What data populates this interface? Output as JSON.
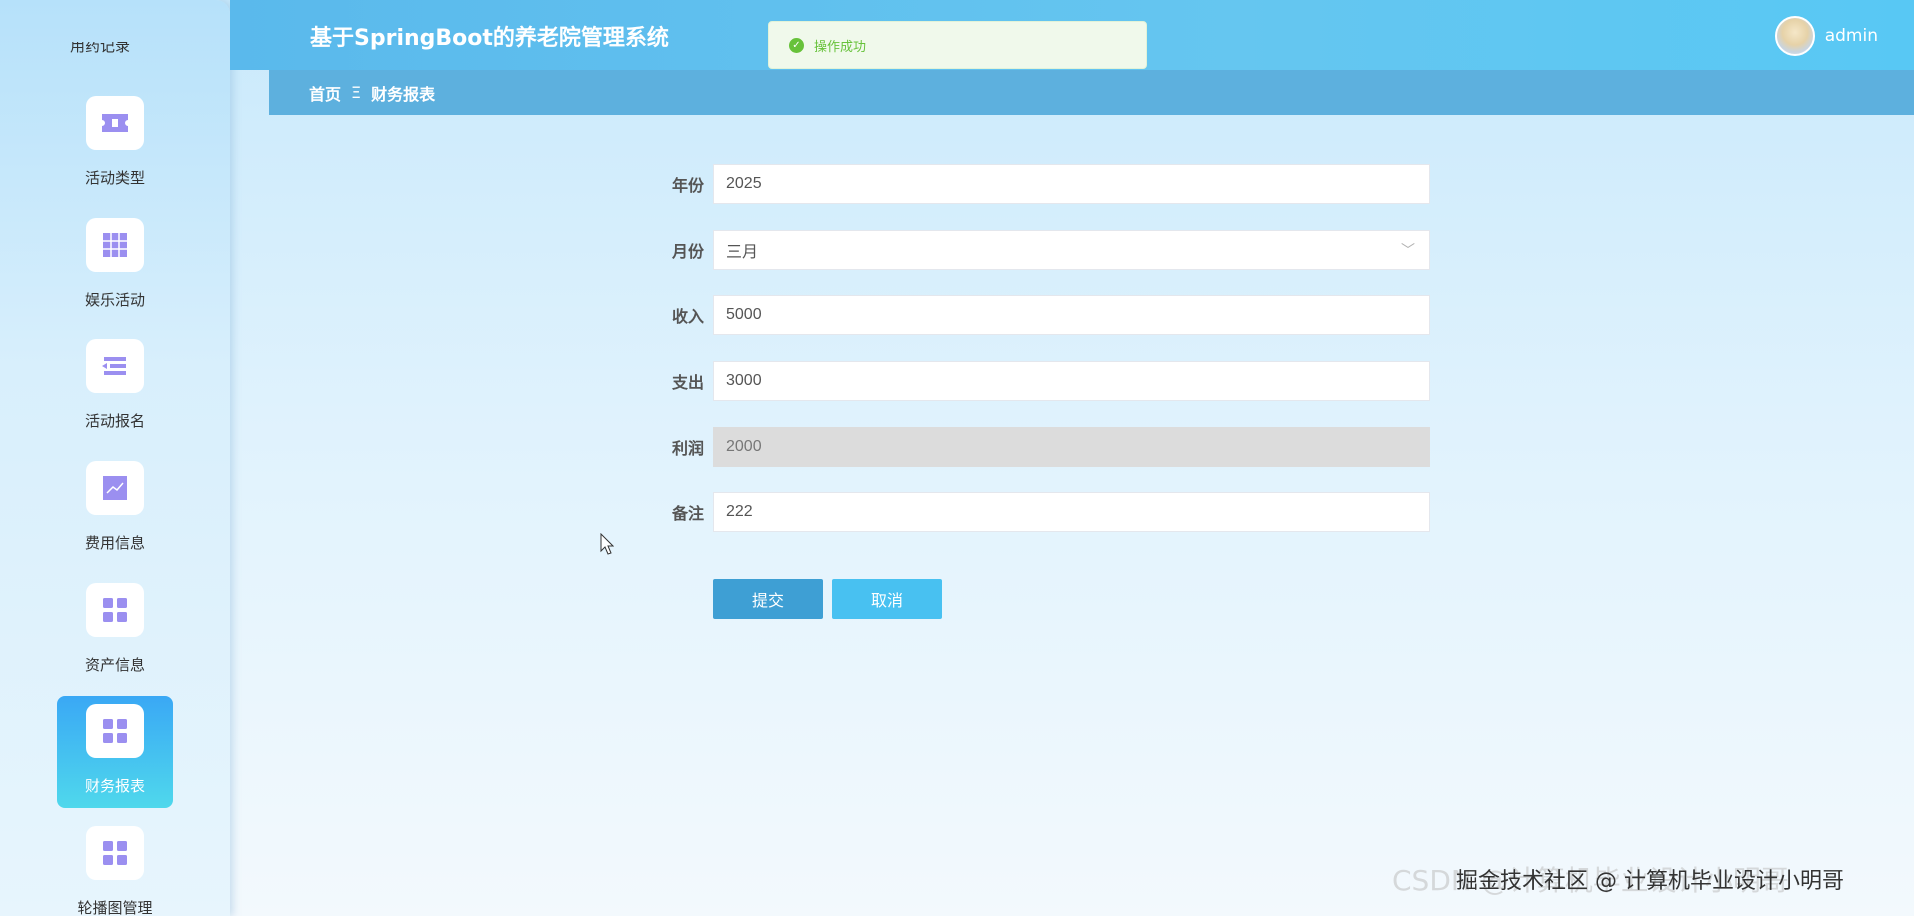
{
  "app": {
    "title": "基于SpringBoot的养老院管理系统"
  },
  "user": {
    "name": "admin"
  },
  "toast": {
    "message": "操作成功"
  },
  "breadcrumb": {
    "home": "首页",
    "separator": "Ξ",
    "current": "财务报表"
  },
  "sidebar": {
    "top_partial_label": "用药记录",
    "items": [
      {
        "label": "活动类型",
        "icon": "ticket-icon"
      },
      {
        "label": "娱乐活动",
        "icon": "grid-icon"
      },
      {
        "label": "活动报名",
        "icon": "list-icon"
      },
      {
        "label": "费用信息",
        "icon": "chart-icon"
      },
      {
        "label": "资产信息",
        "icon": "apps-icon"
      },
      {
        "label": "财务报表",
        "icon": "apps-icon",
        "active": true
      },
      {
        "label": "轮播图管理",
        "icon": "apps-icon"
      }
    ]
  },
  "form": {
    "year": {
      "label": "年份",
      "value": "2025"
    },
    "month": {
      "label": "月份",
      "value": "三月"
    },
    "income": {
      "label": "收入",
      "value": "5000"
    },
    "expense": {
      "label": "支出",
      "value": "3000"
    },
    "profit": {
      "label": "利润",
      "value": "2000"
    },
    "remark": {
      "label": "备注",
      "value": "222"
    },
    "submit_label": "提交",
    "cancel_label": "取消"
  },
  "watermark": {
    "text1": "CSDN @计算机毕业设计小明哥",
    "text2": "掘金技术社区 @ 计算机毕业设计小明哥"
  },
  "colors": {
    "accent": "#5ab9ec",
    "purple_icon": "#9b8ff0",
    "success": "#67c23a"
  }
}
